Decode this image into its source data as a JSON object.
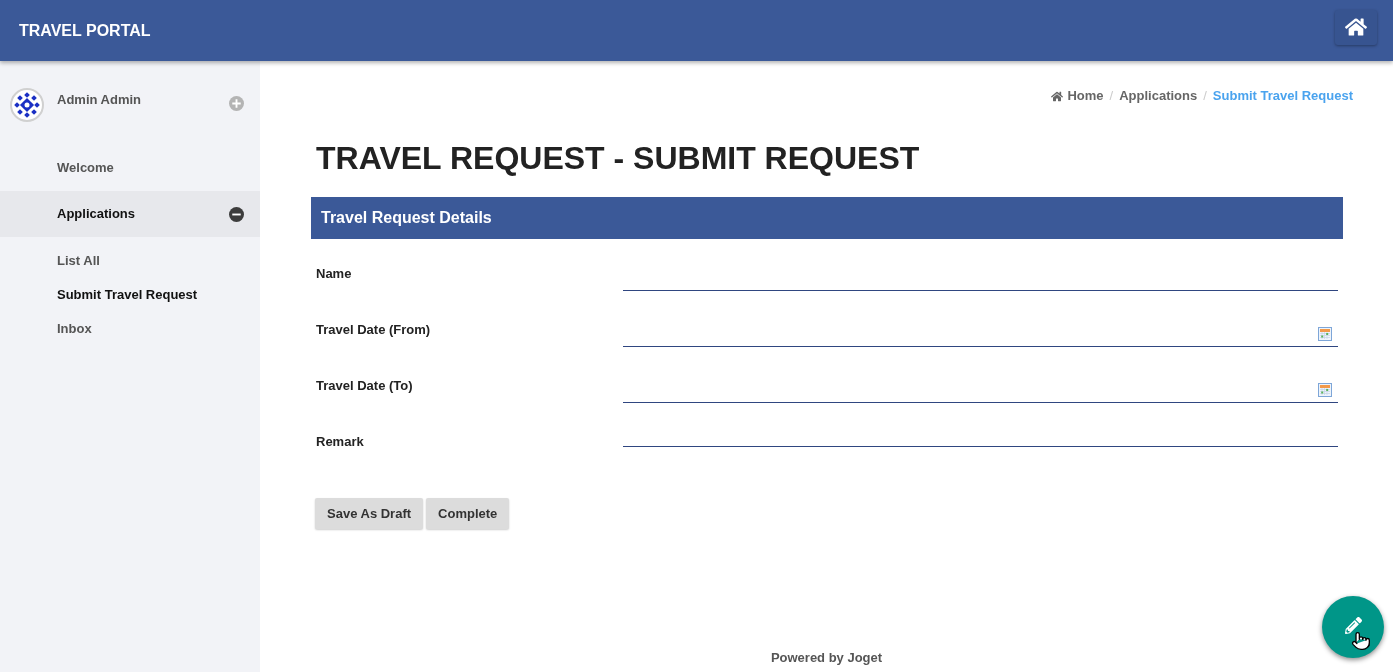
{
  "header": {
    "title": "TRAVEL PORTAL"
  },
  "sidebar": {
    "user": {
      "name": "Admin Admin",
      "expanded": false
    },
    "items": [
      {
        "label": "Welcome",
        "kind": "link",
        "selected": false
      },
      {
        "label": "Applications",
        "kind": "category",
        "selected": true,
        "expanded": true,
        "children": [
          {
            "label": "List All",
            "selected": false
          },
          {
            "label": "Submit Travel Request",
            "selected": true
          },
          {
            "label": "Inbox",
            "selected": false
          }
        ]
      }
    ]
  },
  "breadcrumb": {
    "items": [
      {
        "label": "Home",
        "kind": "home",
        "selected": false
      },
      {
        "label": "Applications",
        "kind": "link",
        "selected": false
      },
      {
        "label": "Submit Travel Request",
        "kind": "link",
        "selected": true
      }
    ],
    "separators": [
      "/",
      "/"
    ]
  },
  "page_title": "TRAVEL REQUEST - SUBMIT REQUEST",
  "form": {
    "title": "Travel Request Details",
    "fields": [
      {
        "label": "Name",
        "kind": "text"
      },
      {
        "label": "Travel Date (From)",
        "kind": "date"
      },
      {
        "label": "Travel Date (To)",
        "kind": "date"
      },
      {
        "label": "Remark",
        "kind": "textarea"
      }
    ],
    "buttons": [
      "Save As Draft",
      "Complete"
    ]
  },
  "footer": "Powered by Joget"
}
